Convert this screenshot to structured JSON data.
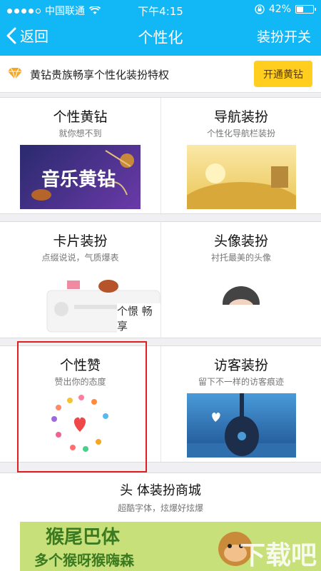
{
  "status_bar": {
    "carrier": "中国联通",
    "time": "下午4:15",
    "battery": "42%",
    "battery_level": 0.42,
    "signal_icon": "signal-dots-icon",
    "wifi_icon": "wifi-icon",
    "lock_icon": "orientation-lock-icon"
  },
  "nav": {
    "back_label": "返回",
    "title": "个性化",
    "right_label": "装扮开关"
  },
  "banner": {
    "text": "黄钻贵族畅享个性化装扮特权",
    "button_label": "开通黄钻"
  },
  "cards": [
    {
      "title": "个性黄钻",
      "subtitle": "就你想不到",
      "thumb_text": "音乐黄钻"
    },
    {
      "title": "导航装扮",
      "subtitle": "个性化导航栏装扮"
    },
    {
      "title": "卡片装扮",
      "subtitle": "点缀说说，气质爆表",
      "thumb_text": "个憬 畅享"
    },
    {
      "title": "头像装扮",
      "subtitle": "衬托最美的头像"
    },
    {
      "title": "个性赞",
      "subtitle": "赞出你的态度"
    },
    {
      "title": "访客装扮",
      "subtitle": "留下不一样的访客痕迹"
    }
  ],
  "mall": {
    "title": "头 体装扮商城",
    "subtitle": "超酷字体，炫爆好炫爆",
    "banner_line1": "猴尾巴体",
    "banner_line2": "多个猴呀猴嗨森",
    "watermark": "下载吧"
  },
  "colors": {
    "header": "#12b7f5",
    "banner_button": "#ffce1e",
    "highlight": "#e02020"
  }
}
